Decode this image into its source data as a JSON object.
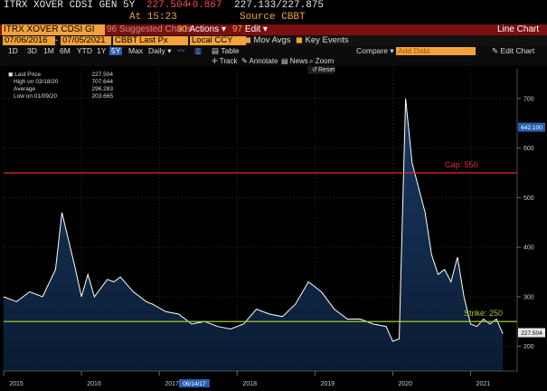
{
  "header": {
    "ticker": "ITRX XOVER CDSI GEN 5Y",
    "price": "227.504",
    "change": "+0.867",
    "bid_ask": "227.133/227.875",
    "time_label": "At 15:23",
    "source_label": "Source CBBT"
  },
  "toolbar": {
    "security_input": "ITRX XOVER CDSI GI",
    "suggested_charts": "96 Suggested Charts",
    "actions": "Actions",
    "actions_num": "90",
    "edit": "Edit",
    "edit_num": "97",
    "chart_type": "Line Chart"
  },
  "controls": {
    "start_date": "07/06/2016",
    "end_date": "07/05/2021",
    "source": "CBBT",
    "field": "Last Px",
    "currency": "Local CCY",
    "mov_avgs": "Mov Avgs",
    "key_events": "Key Events"
  },
  "periods": [
    "1D",
    "3D",
    "1M",
    "6M",
    "YTD",
    "1Y",
    "5Y",
    "Max"
  ],
  "period_selected": "5Y",
  "frequency": "Daily",
  "table_label": "Table",
  "compare_label": "Compare",
  "add_data_placeholder": "Add Data",
  "edit_chart": "Edit Chart",
  "tools": {
    "track": "Track",
    "annotate": "Annotate",
    "news": "News",
    "zoom": "Zoom",
    "reset": "Reset"
  },
  "legend": [
    {
      "label": "Last Price",
      "value": "227.504"
    },
    {
      "label": "High on 03/18/20",
      "value": "707.644"
    },
    {
      "label": "Average",
      "value": "296.283"
    },
    {
      "label": "Low on 01/09/20",
      "value": "203.665"
    }
  ],
  "colors": {
    "accent_orange": "#f2a23a",
    "toolbar_red": "#7a1010",
    "cap_line": "#e03030",
    "strike_line": "#9acd32",
    "series": "#ffffff",
    "fill_bottom": "#0a1c33",
    "fill_top": "#1b3a63"
  },
  "chart_data": {
    "type": "area",
    "x_labels": [
      "2015",
      "2016",
      "2017",
      "2018",
      "2019",
      "2020",
      "2021"
    ],
    "date_tooltip": "06/14/17",
    "ylim": [
      150,
      760
    ],
    "y_ticks": [
      200,
      300,
      400,
      500,
      600,
      700
    ],
    "last_value_label": "227.504",
    "hover_value_label": "642.100",
    "reference_lines": [
      {
        "name": "Cap: 550",
        "value": 550
      },
      {
        "name": "Strike: 250",
        "value": 250
      }
    ],
    "series": [
      {
        "x": [
          "2015-01",
          "2015-03",
          "2015-05",
          "2015-07",
          "2015-09",
          "2015-10",
          "2015-12",
          "2016-01",
          "2016-02",
          "2016-03",
          "2016-05",
          "2016-06",
          "2016-07",
          "2016-09",
          "2016-11",
          "2016-12",
          "2017-02",
          "2017-04",
          "2017-06",
          "2017-08",
          "2017-10",
          "2017-12",
          "2018-02",
          "2018-04",
          "2018-06",
          "2018-08",
          "2018-10",
          "2018-12",
          "2019-02",
          "2019-04",
          "2019-06",
          "2019-08",
          "2019-10",
          "2019-12",
          "2020-01",
          "2020-02",
          "2020-03",
          "2020-04",
          "2020-05",
          "2020-06",
          "2020-07",
          "2020-08",
          "2020-09",
          "2020-10",
          "2020-11",
          "2020-12",
          "2021-01",
          "2021-02",
          "2021-03",
          "2021-04",
          "2021-05",
          "2021-06"
        ],
        "y": [
          300,
          290,
          310,
          300,
          355,
          470,
          360,
          300,
          345,
          300,
          335,
          330,
          340,
          310,
          290,
          285,
          270,
          265,
          245,
          250,
          240,
          235,
          245,
          275,
          265,
          260,
          285,
          330,
          310,
          275,
          255,
          255,
          245,
          240,
          210,
          215,
          700,
          570,
          520,
          470,
          385,
          345,
          355,
          330,
          380,
          300,
          245,
          240,
          255,
          245,
          255,
          225
        ]
      }
    ]
  }
}
